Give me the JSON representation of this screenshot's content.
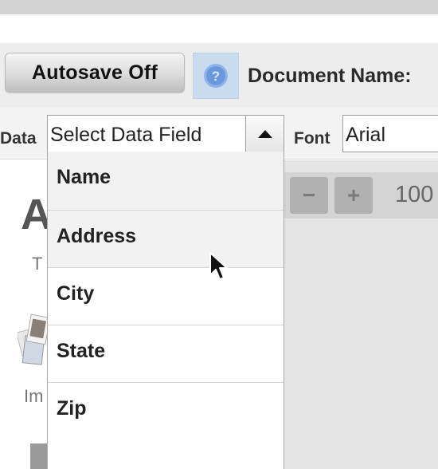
{
  "toolbar": {
    "autosave_label": "Autosave Off",
    "help_icon": "question-circle-icon",
    "document_name_label": "Document Name:"
  },
  "properties": {
    "data_label": "Data",
    "data_select_value": "Select Data Field",
    "font_label": "Font",
    "font_value": "Arial"
  },
  "dropdown": {
    "items": [
      {
        "label": "Name"
      },
      {
        "label": "Address"
      },
      {
        "label": "City"
      },
      {
        "label": "State"
      },
      {
        "label": "Zip"
      }
    ],
    "hovered_index": 1
  },
  "canvas": {
    "big_letter": "A",
    "small_letter": "T",
    "image_label": "Im"
  },
  "zoom": {
    "minus_label": "−",
    "plus_label": "+",
    "value": "100"
  },
  "colors": {
    "toolbar_bg": "#ededed",
    "help_button_bg": "#c9dcef",
    "help_icon_color": "#5f8fd8",
    "canvas_bg": "#e4e4e4"
  }
}
